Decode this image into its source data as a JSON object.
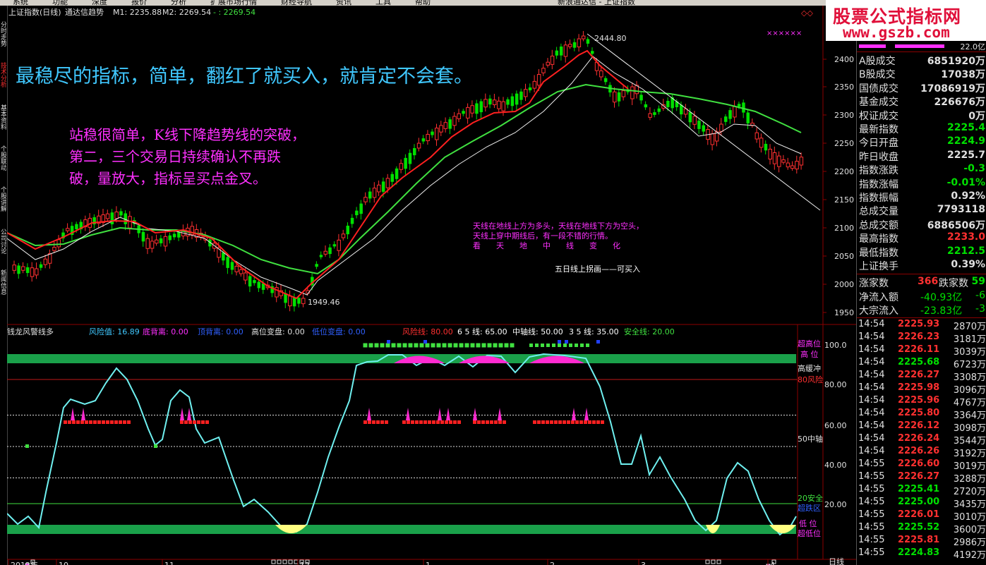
{
  "menu": {
    "items": [
      "系统",
      "功能",
      "深度",
      "报价",
      "分析",
      "扩展市场行情",
      "财经导航",
      "资讯",
      "工具",
      "帮助"
    ],
    "window_title": "新浪通达信 - 上证指数"
  },
  "left_tabs": [
    "分时走势",
    "技术分析",
    "基本资料",
    "个股联动",
    "个股讲解",
    "公司讨论",
    "新闻信息"
  ],
  "main_chart": {
    "header": {
      "title": "上证指数(日线)",
      "indicator": "通达信趋势",
      "m1": "M1: 2235.88",
      "m2": "M2: 2269.54",
      "extra": "- : 2269.54"
    },
    "headline": "最稳尽的指标，简单，翻红了就买入，就肯定不会套。",
    "note_lines": [
      "站稳很简单，K线下降趋势线的突破，",
      "第二，三个交易日持续确认不再跌",
      "破，量放大，指标呈买点金叉。"
    ],
    "small_note_lines": [
      "天线在地线上方为多头，天线在地线下方为空头，",
      "天线上穿中期线后，有一段不错的行情。",
      "看　　天　　地　　中　　线　　变　　化"
    ],
    "caption": "五日线上拐画——可买入",
    "high_label": "2444.80",
    "low_label": "1949.46",
    "markers": "××××××",
    "y_ticks": [
      "2400",
      "2350",
      "2300",
      "2250",
      "2200",
      "2150",
      "2100",
      "2050",
      "2000",
      "1950"
    ]
  },
  "sub_chart": {
    "header": {
      "title": "钱龙风警线多",
      "risk": "风险值: 16.89",
      "bottom": "底背离: 0.00",
      "top": "顶背离: 0.00",
      "high_change": "高位变盘: 0.00",
      "low_change": "低位变盘: 0.00",
      "risk_line": "风险线: 80.00",
      "line65": "6 5 线: 65.00",
      "mid": "中轴线: 50.00",
      "line35": "3 5 线: 35.00",
      "safe": "安全线: 20.00"
    },
    "y_ticks": [
      "100.0",
      "80.00",
      "60.00",
      "40.00",
      "20.00"
    ],
    "right_labels": [
      "超高位",
      "高 位",
      "高缓冲",
      "80风险",
      "50中轴",
      "20安全",
      "超跌区",
      "低 位",
      "超低位"
    ]
  },
  "x_axis": [
    "2012年",
    "10",
    "11",
    "12",
    "1",
    "2",
    "3",
    "4"
  ],
  "period_label": "日线",
  "logo": {
    "main": "股票公式指标网",
    "url": "www.gszb.com"
  },
  "quote_panel": {
    "top_value": "22.0亿",
    "rows": [
      {
        "label": "A股成交",
        "value": "6851920万",
        "color": "#e0e0e0"
      },
      {
        "label": "B股成交",
        "value": "17038万",
        "color": "#e0e0e0"
      },
      {
        "label": "国债成交",
        "value": "17086919万",
        "color": "#e0e0e0"
      },
      {
        "label": "基金成交",
        "value": "226676万",
        "color": "#e0e0e0"
      },
      {
        "label": "权证成交",
        "value": "0万",
        "color": "#e0e0e0"
      },
      {
        "label": "最新指数",
        "value": "2225.4",
        "color": "#00e000"
      },
      {
        "label": "今日开盘",
        "value": "2224.9",
        "color": "#00e000"
      },
      {
        "label": "昨日收盘",
        "value": "2225.7",
        "color": "#e0e0e0"
      },
      {
        "label": "指数涨跌",
        "value": "-0.3",
        "color": "#00e000"
      },
      {
        "label": "指数涨幅",
        "value": "-0.01%",
        "color": "#00e000"
      },
      {
        "label": "指数振幅",
        "value": "0.92%",
        "color": "#e0e0e0"
      },
      {
        "label": "总成交量",
        "value": "7793118",
        "color": "#e0e0e0"
      },
      {
        "label": "总成交额",
        "value": "6886506万",
        "color": "#e0e0e0"
      },
      {
        "label": "最高指数",
        "value": "2233.0",
        "color": "#ff3030"
      },
      {
        "label": "最低指数",
        "value": "2212.5",
        "color": "#00e000"
      },
      {
        "label": "上证换手",
        "value": "0.39%",
        "color": "#e0e0e0"
      }
    ],
    "rise_label": "涨家数",
    "rise_value": "366",
    "fall_label": "跌家数",
    "fall_value": "59",
    "netflow_label": "净流入额",
    "netflow_value": "-40.93亿",
    "netflow_extra": "-6",
    "bigflow_label": "大宗流入",
    "bigflow_value": "-23.83亿",
    "bigflow_extra": "-3"
  },
  "ticks": [
    {
      "time": "14:54",
      "price": "2225.93",
      "vol": "2870万",
      "color": "#ff3030"
    },
    {
      "time": "14:54",
      "price": "2226.23",
      "vol": "3181万",
      "color": "#ff3030"
    },
    {
      "time": "14:54",
      "price": "2226.11",
      "vol": "3039万",
      "color": "#ff3030"
    },
    {
      "time": "14:54",
      "price": "2225.68",
      "vol": "6723万",
      "color": "#00e000"
    },
    {
      "time": "14:54",
      "price": "2226.27",
      "vol": "3308万",
      "color": "#ff3030"
    },
    {
      "time": "14:54",
      "price": "2225.98",
      "vol": "3096万",
      "color": "#ff3030"
    },
    {
      "time": "14:54",
      "price": "2225.96",
      "vol": "4767万",
      "color": "#ff3030"
    },
    {
      "time": "14:54",
      "price": "2225.80",
      "vol": "3364万",
      "color": "#ff3030"
    },
    {
      "time": "14:54",
      "price": "2226.12",
      "vol": "3098万",
      "color": "#ff3030"
    },
    {
      "time": "14:54",
      "price": "2226.24",
      "vol": "3544万",
      "color": "#ff3030"
    },
    {
      "time": "14:54",
      "price": "2226.26",
      "vol": "3192万",
      "color": "#ff3030"
    },
    {
      "time": "14:55",
      "price": "2226.60",
      "vol": "3019万",
      "color": "#ff3030"
    },
    {
      "time": "14:55",
      "price": "2226.27",
      "vol": "3288万",
      "color": "#ff3030"
    },
    {
      "time": "14:55",
      "price": "2225.41",
      "vol": "2720万",
      "color": "#00e000"
    },
    {
      "time": "14:55",
      "price": "2225.00",
      "vol": "3435万",
      "color": "#00e000"
    },
    {
      "time": "14:55",
      "price": "2226.01",
      "vol": "3010万",
      "color": "#ff3030"
    },
    {
      "time": "14:55",
      "price": "2225.52",
      "vol": "3600万",
      "color": "#00e000"
    },
    {
      "time": "14:55",
      "price": "2225.81",
      "vol": "2986万",
      "color": "#ff3030"
    },
    {
      "time": "14:55",
      "price": "2224.83",
      "vol": "4192万",
      "color": "#00e000"
    }
  ],
  "colors": {
    "up": "#ff3030",
    "down": "#00e000",
    "ma_red": "#ff2020",
    "ma_green": "#40e040",
    "ma_white": "#f0f0f0",
    "osc": "#6ff0f0",
    "band": "#1aa04a",
    "magenta": "#ff2ad0",
    "headline": "#40c8ff",
    "note": "#ff30ff"
  }
}
